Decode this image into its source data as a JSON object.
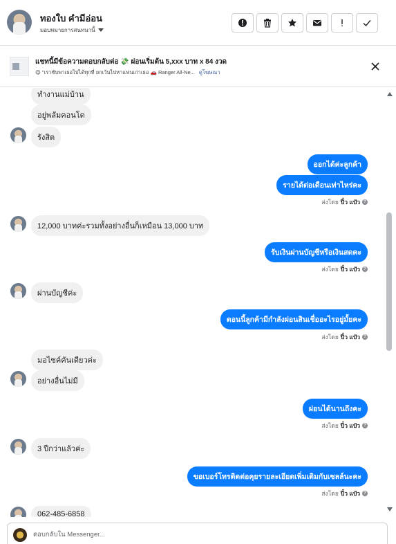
{
  "header": {
    "contact_name": "ทองใบ คำมีอ่อน",
    "assign_label": "มอบหมายการสนทนานี้"
  },
  "toolbar": {
    "icons": [
      "spam-icon",
      "trash-icon",
      "star-icon",
      "mail-icon",
      "exclamation-icon",
      "check-icon"
    ]
  },
  "ad": {
    "title": "แชทนี้มีข้อความตอบกลับต่อ 💸 ผ่อนเริ่มต้น 5,xxx บาท x 84 งวด",
    "subtitle": "😋 \"เราชับพาเธอไปได้ทุกที่ ยกเว้นไปหาแฟนเก่าเธอ 🚗 Ranger All-Ne...",
    "link": "ดูโฆษณา"
  },
  "messages": [
    {
      "dir": "in",
      "text": "ทำงานแม่บ้าน"
    },
    {
      "dir": "in",
      "text": "อยู่พลัมคอนโด"
    },
    {
      "dir": "in",
      "text": "รังสิต"
    },
    {
      "dir": "out",
      "text": "ออกได้ค่ะลูกค้า"
    },
    {
      "dir": "out",
      "text": "รายได้ต่อเดือนเท่าไหร่คะ"
    },
    {
      "dir": "in",
      "text": "12,000 บาทค่ะรวมทั้งอย่างอื่นก็เหมือน 13,000 บาท"
    },
    {
      "dir": "out",
      "text": "รับเงินผ่านบัญชีหรือเงินสดคะ"
    },
    {
      "dir": "in",
      "text": "ผ่านบัญชีค่ะ"
    },
    {
      "dir": "out",
      "text": "ตอนนี้ลูกค้ามีกำลังผ่อนสินเชื่ออะไรอยู่มั้ยคะ"
    },
    {
      "dir": "in",
      "text": "มอไซค์คันเดียวค่ะ"
    },
    {
      "dir": "in",
      "text": "อย่างอื่นไม่มี"
    },
    {
      "dir": "out",
      "text": "ผ่อนได้นานถึงคะ"
    },
    {
      "dir": "in",
      "text": "3 ปีกว่าแล้วค่ะ"
    },
    {
      "dir": "out",
      "text": "ขอเบอร์โทรติดต่อคุยรายละเอียดเพิ่มเติมกับเซลล์นะคะ"
    },
    {
      "dir": "in",
      "text": "062-485-6858"
    }
  ],
  "sent_by": {
    "prefix": "ส่งโดย",
    "sender": "ปิ๋ว แป๋ว"
  },
  "composer": {
    "placeholder": "ตอบกลับใน Messenger..."
  }
}
